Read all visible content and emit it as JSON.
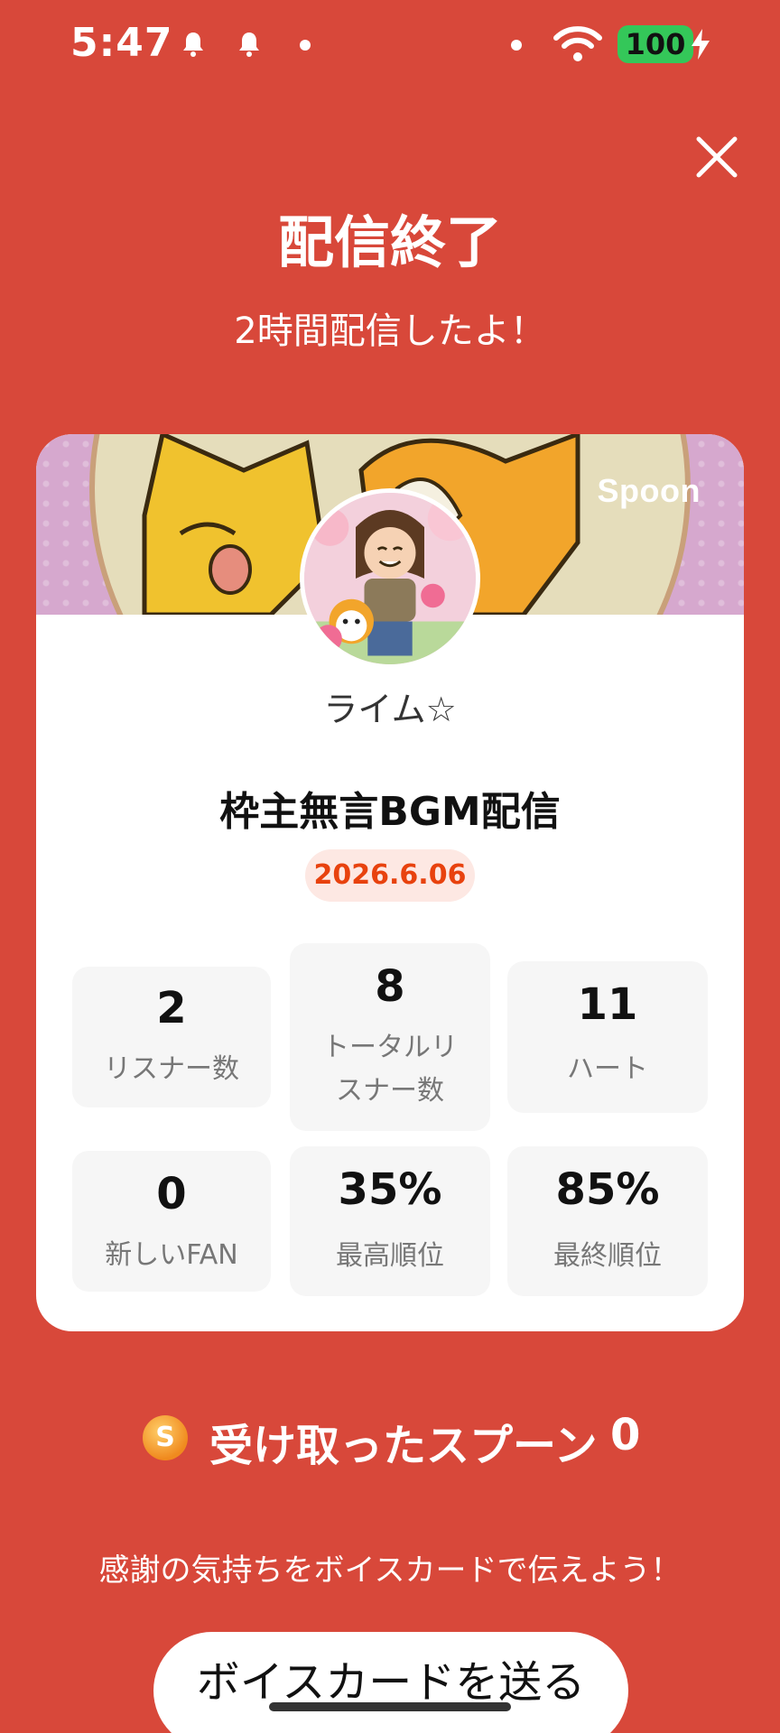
{
  "status_bar": {
    "time": "5:47",
    "battery": "100"
  },
  "header": {
    "title": "配信終了",
    "subtitle": "2時間配信したよ！"
  },
  "card": {
    "brand": "Spoon",
    "username": "ライム☆",
    "stream_title": "枠主無言BGM配信",
    "date": "2026.6.06"
  },
  "stats": [
    {
      "value": "2",
      "label": "リスナー数"
    },
    {
      "value": "8",
      "label_line1": "トータルリ",
      "label_line2": "スナー数"
    },
    {
      "value": "11",
      "label": "ハート"
    },
    {
      "value": "0",
      "label": "新しいFAN"
    },
    {
      "value": "35%",
      "label": "最高順位"
    },
    {
      "value": "85%",
      "label": "最終順位"
    }
  ],
  "spoons": {
    "coin_letter": "S",
    "label": "受け取ったスプーン",
    "count": "0"
  },
  "footer": {
    "message": "感謝の気持ちをボイスカードで伝えよう！",
    "button_label": "ボイスカードを送る"
  },
  "colors": {
    "background": "#D8483A",
    "accent": "#E8420E",
    "battery": "#34C759"
  },
  "icons": [
    "bell-icon",
    "dot-icon",
    "wifi-icon",
    "charging-bolt-icon",
    "close-icon",
    "spoon-coin-icon"
  ]
}
